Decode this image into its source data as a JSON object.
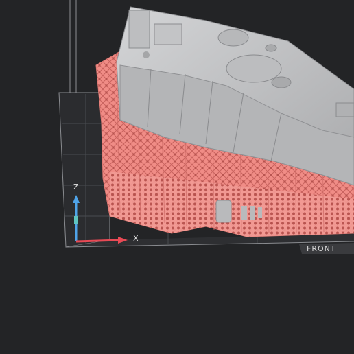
{
  "viewport": {
    "background_color": "#232426",
    "build_plate": {
      "front_label": "FRONT",
      "grid_color": "#4a4c50",
      "edge_color": "#8a8c90"
    },
    "axis_gizmo": {
      "z_label": "Z",
      "x_label": "X",
      "z_color": "#4fa3e8",
      "x_color": "#e84a55"
    },
    "model": {
      "body_color": "#c9cacc",
      "support_color": "#f08c86",
      "description_icon": "3d-print-model-with-supports"
    }
  }
}
